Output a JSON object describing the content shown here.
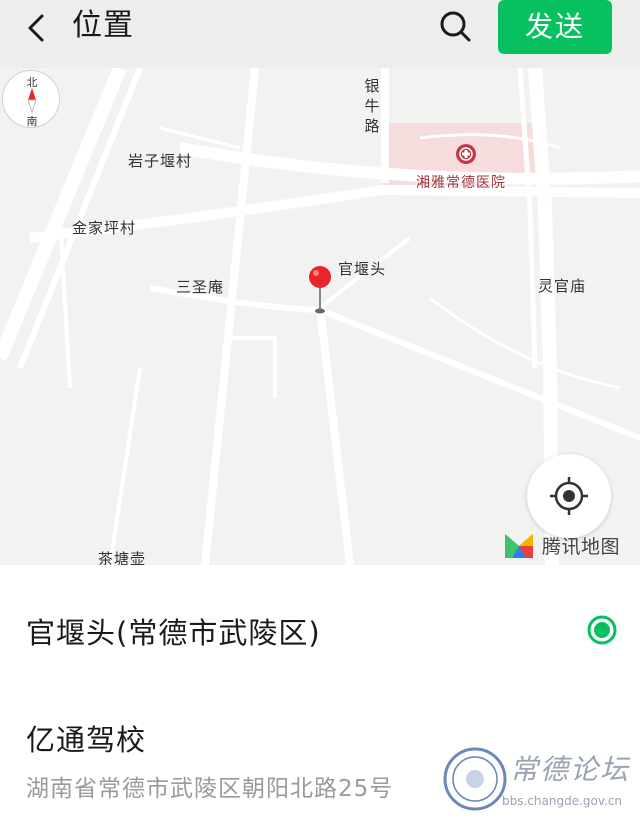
{
  "header": {
    "title": "位置",
    "send_label": "发送"
  },
  "map": {
    "compass": {
      "north": "北",
      "south": "南"
    },
    "labels": {
      "yinniu_road": [
        "银",
        "牛",
        "路"
      ],
      "hospital": "湘雅常德医院",
      "yanziyan": "岩子堰村",
      "jinjiaping": "金家坪村",
      "guanyantou": "官堰头",
      "sanshengan": "三圣庵",
      "lingguanmiao": "灵官庙",
      "chatanghu": "茶塘壶"
    },
    "brand": "腾讯地图"
  },
  "results": [
    {
      "title": "官堰头(常德市武陵区)",
      "selected": true
    },
    {
      "title": "亿通驾校",
      "address": "湖南省常德市武陵区朝阳北路25号"
    }
  ],
  "watermark": {
    "text": "常德论坛",
    "url": "bbs.changde.gov.cn"
  },
  "colors": {
    "accent": "#07c160",
    "pin": "#e8252a",
    "hospital_area": "#f6dcdc",
    "map_bg": "#f2f2f0"
  }
}
